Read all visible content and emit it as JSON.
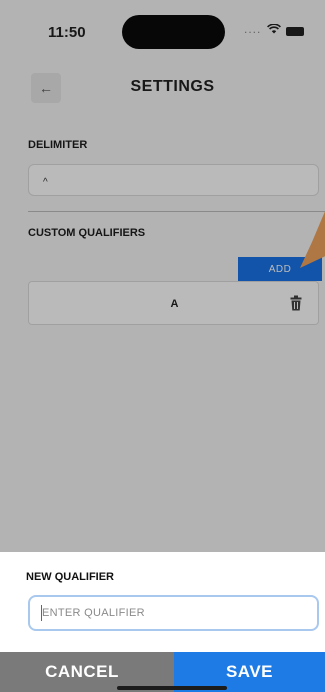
{
  "status_bar": {
    "time": "11:50",
    "signal": "...."
  },
  "header": {
    "back_icon": "arrow-left-icon",
    "back_glyph": "←",
    "title": "SETTINGS"
  },
  "delimiter": {
    "label": "DELIMITER",
    "value": "^"
  },
  "custom_qualifiers": {
    "label": "CUSTOM QUALIFIERS",
    "add_label": "ADD",
    "items": [
      {
        "label": "A",
        "icon": "trash-icon"
      }
    ]
  },
  "sheet": {
    "label": "NEW QUALIFIER",
    "input_placeholder": "ENTER QUALIFIER",
    "input_value": "",
    "cancel_label": "CANCEL",
    "save_label": "SAVE"
  },
  "colors": {
    "accent": "#1a73e8",
    "cancel": "#7a7a7a",
    "annotation_arrow": "#f0a35e"
  }
}
